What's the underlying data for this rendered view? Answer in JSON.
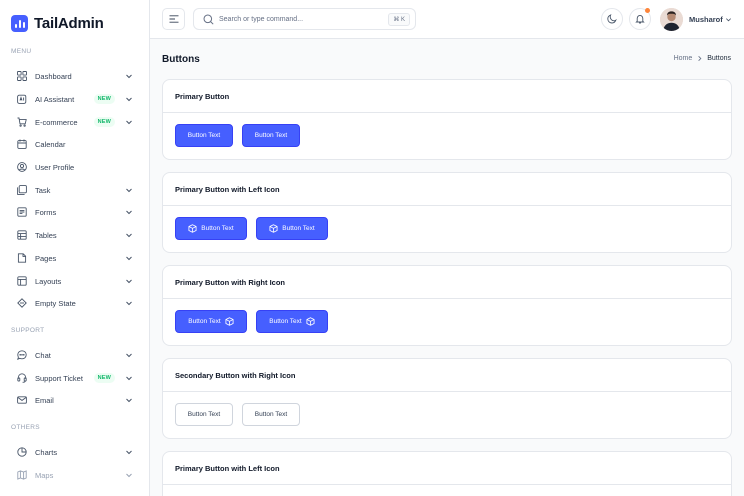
{
  "brand": {
    "name": "TailAdmin"
  },
  "sidebar": {
    "menu_label": "MENU",
    "support_label": "SUPPORT",
    "others_label": "OTHERS",
    "items": [
      {
        "label": "Dashboard",
        "icon": "grid-icon",
        "chevron": true
      },
      {
        "label": "AI Assistant",
        "icon": "ai-icon",
        "badge": "NEW",
        "chevron": true
      },
      {
        "label": "E-commerce",
        "icon": "cart-icon",
        "badge": "NEW",
        "chevron": true
      },
      {
        "label": "Calendar",
        "icon": "calendar-icon",
        "chevron": false
      },
      {
        "label": "User Profile",
        "icon": "user-circle-icon",
        "chevron": false
      },
      {
        "label": "Task",
        "icon": "task-icon",
        "chevron": true
      },
      {
        "label": "Forms",
        "icon": "form-icon",
        "chevron": true
      },
      {
        "label": "Tables",
        "icon": "table-icon",
        "chevron": true
      },
      {
        "label": "Pages",
        "icon": "pages-icon",
        "chevron": true
      },
      {
        "label": "Layouts",
        "icon": "layout-icon",
        "chevron": true
      },
      {
        "label": "Empty State",
        "icon": "empty-state-icon",
        "chevron": true
      },
      {
        "label": "Chat",
        "icon": "chat-icon",
        "chevron": true
      },
      {
        "label": "Support Ticket",
        "icon": "headset-icon",
        "badge": "NEW",
        "chevron": true
      },
      {
        "label": "Email",
        "icon": "mail-icon",
        "chevron": true
      },
      {
        "label": "Charts",
        "icon": "pie-chart-icon",
        "chevron": true
      },
      {
        "label": "Maps",
        "icon": "map-icon",
        "chevron": true
      }
    ]
  },
  "header": {
    "search_placeholder": "Search or type command...",
    "shortcut": "⌘ K",
    "user_name": "Musharof"
  },
  "page": {
    "title": "Buttons",
    "breadcrumb": {
      "home": "Home",
      "current": "Buttons"
    }
  },
  "cards": [
    {
      "title": "Primary Button",
      "buttons": [
        "Button Text",
        "Button Text"
      ]
    },
    {
      "title": "Primary Button with Left Icon",
      "buttons": [
        "Button Text",
        "Button Text"
      ]
    },
    {
      "title": "Primary Button with Right Icon",
      "buttons": [
        "Button Text",
        "Button Text"
      ]
    },
    {
      "title": "Secondary Button with Right Icon",
      "buttons": [
        "Button Text",
        "Button Text"
      ]
    },
    {
      "title": "Primary Button with Left Icon"
    }
  ],
  "colors": {
    "primary": "#465fff",
    "badge_green": "#12b76a",
    "notification": "#fd853a"
  }
}
